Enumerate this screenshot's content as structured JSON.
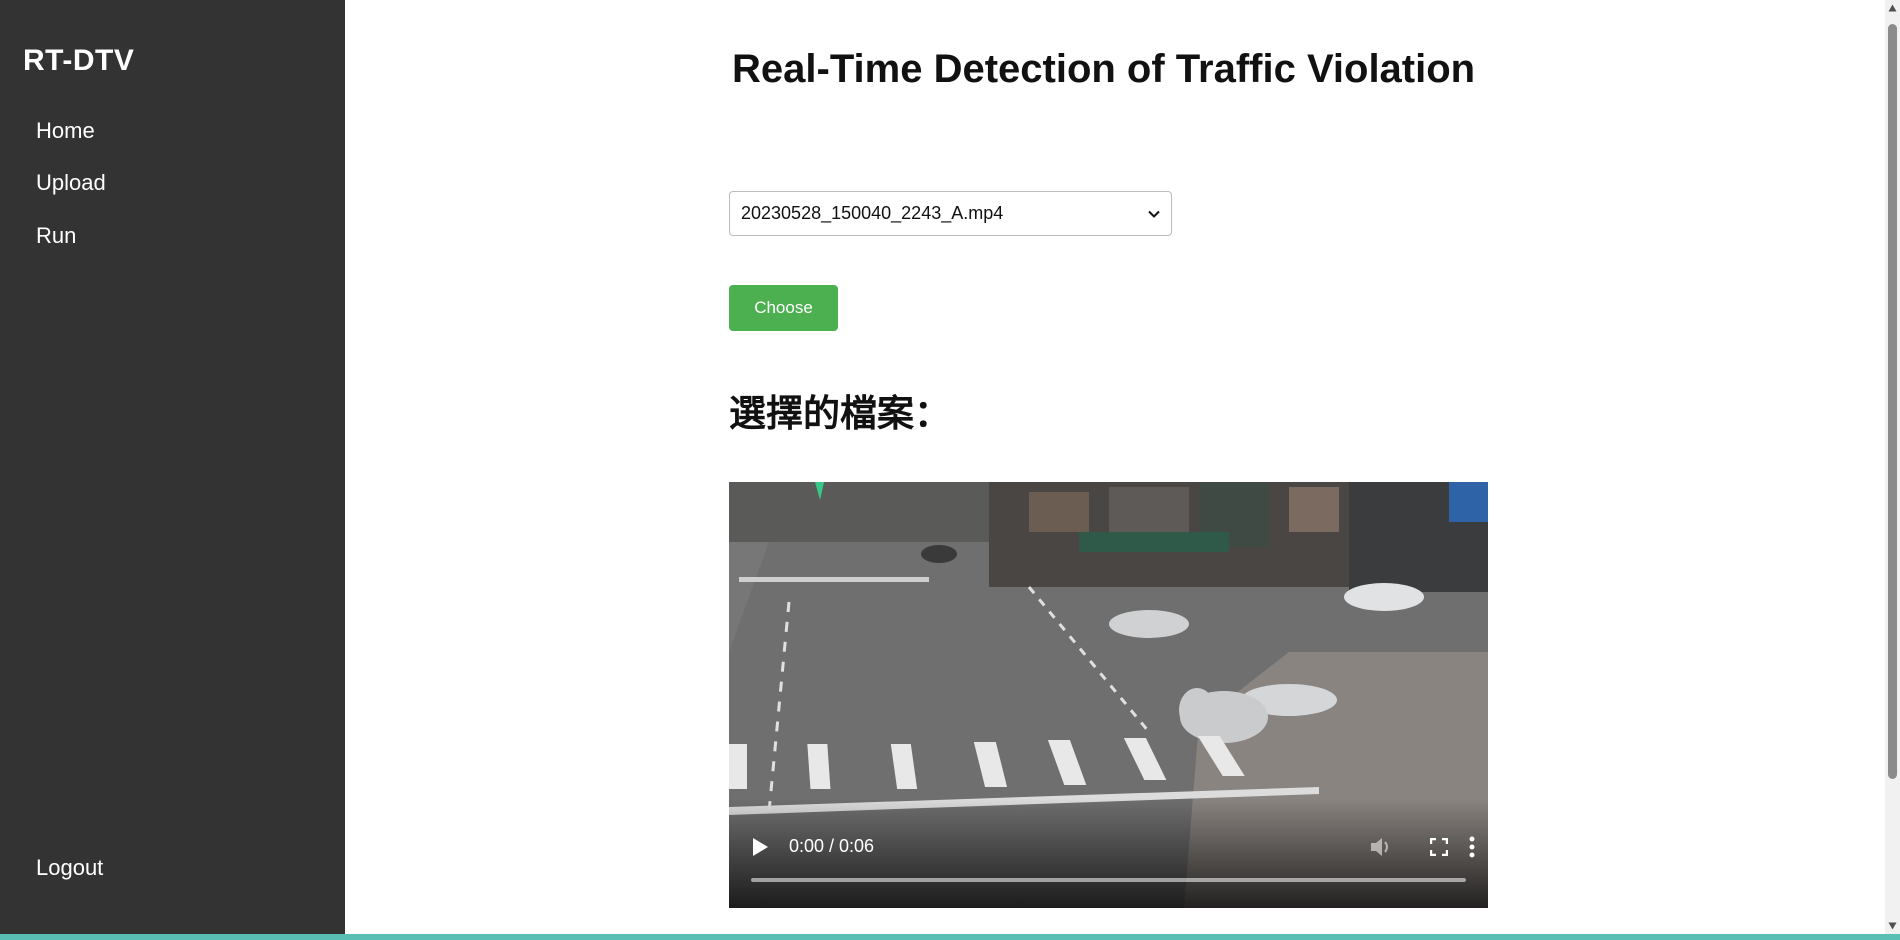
{
  "sidebar": {
    "brand": "RT-DTV",
    "items": [
      {
        "label": "Home"
      },
      {
        "label": "Upload"
      },
      {
        "label": "Run"
      }
    ],
    "logout_label": "Logout"
  },
  "main": {
    "title": "Real-Time Detection of Traffic Violation",
    "file_select": {
      "selected": "20230528_150040_2243_A.mp4"
    },
    "choose_label": "Choose",
    "selected_heading": "選擇的檔案："
  },
  "video": {
    "time": "0:00 / 0:06",
    "progress": 0
  },
  "icons": [
    "chevron-down-icon",
    "play-icon",
    "volume-icon",
    "fullscreen-icon",
    "more-vert-icon",
    "scroll-up-icon",
    "scroll-down-icon"
  ],
  "colors": {
    "sidebar_bg": "#333333",
    "accent_green": "#4caf50",
    "bottom_strip": "#59bfb5"
  }
}
